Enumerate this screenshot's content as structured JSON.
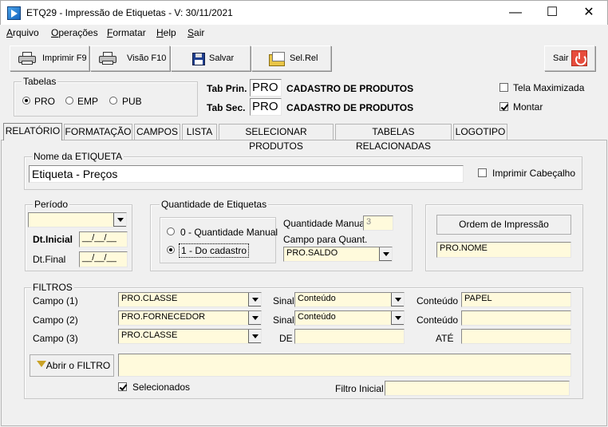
{
  "window": {
    "title": "ETQ29 - Impressão de Etiquetas - V: 30/11/2021",
    "minimize": "—",
    "maximize": "☐",
    "close": "✕"
  },
  "menu": [
    {
      "first": "A",
      "rest": "rquivo"
    },
    {
      "first": "O",
      "rest": "perações"
    },
    {
      "first": "F",
      "rest": "ormatar"
    },
    {
      "first": "H",
      "rest": "elp"
    },
    {
      "first": "S",
      "rest": "air"
    }
  ],
  "toolbar": {
    "imprimir": "Imprimir F9",
    "visao": "Visão F10",
    "salvar": "Salvar",
    "selrel": "Sel.Rel",
    "sair": "Sair"
  },
  "tabelas": {
    "label": "Tabelas",
    "options": [
      "PRO",
      "EMP",
      "PUB"
    ],
    "selected": "PRO",
    "tab_prin_label": "Tab Prin.",
    "tab_prin_value": "PRO",
    "tab_prin_desc": "CADASTRO DE PRODUTOS",
    "tab_sec_label": "Tab Sec.",
    "tab_sec_value": "PRO",
    "tab_sec_desc": "CADASTRO DE PRODUTOS",
    "tela_maximizada": "Tela Maximizada",
    "montar": "Montar"
  },
  "tabs": [
    "RELATÓRIO",
    "FORMATAÇÃO",
    "CAMPOS",
    "LISTA",
    "SELECIONAR PRODUTOS",
    "TABELAS RELACIONADAS",
    "LOGOTIPO"
  ],
  "relatorio": {
    "nome_label": "Nome da ETIQUETA",
    "nome_value": "Etiqueta - Preços",
    "imprimir_cabecalho": "Imprimir Cabeçalho",
    "periodo_label": "Período",
    "dt_inicial_label": "Dt.Inicial",
    "dt_inicial_value": "__/__/__",
    "dt_final_label": "Dt.Final",
    "dt_final_value": "__/__/__",
    "quantidade_label": "Quantidade de Etiquetas",
    "qtd_opt0": "0 - Quantidade Manual",
    "qtd_opt1": "1 - Do cadastro",
    "qtd_manual_label": "Quantidade Manual",
    "qtd_manual_value": "3",
    "campo_quant_label": "Campo para Quant.",
    "campo_quant_value": "PRO.SALDO",
    "ordem_button": "Ordem de Impressão",
    "ordem_value": "PRO.NOME"
  },
  "filtros": {
    "label": "FILTROS",
    "campo1_label": "Campo (1)",
    "campo1_value": "PRO.CLASSE",
    "campo2_label": "Campo (2)",
    "campo2_value": "PRO.FORNECEDOR",
    "campo3_label": "Campo (3)",
    "campo3_value": "PRO.CLASSE",
    "sinal_label": "Sinal",
    "sinal1_value": "Conteúdo",
    "sinal2_value": "Conteúdo",
    "de_label": "DE",
    "conteudo_label": "Conteúdo",
    "conteudo1_value": "PAPEL",
    "ate_label": "ATÉ",
    "abrir_filtro": "Abrir o FILTRO",
    "selecionados": "Selecionados",
    "filtro_inicial": "Filtro Inicial"
  }
}
